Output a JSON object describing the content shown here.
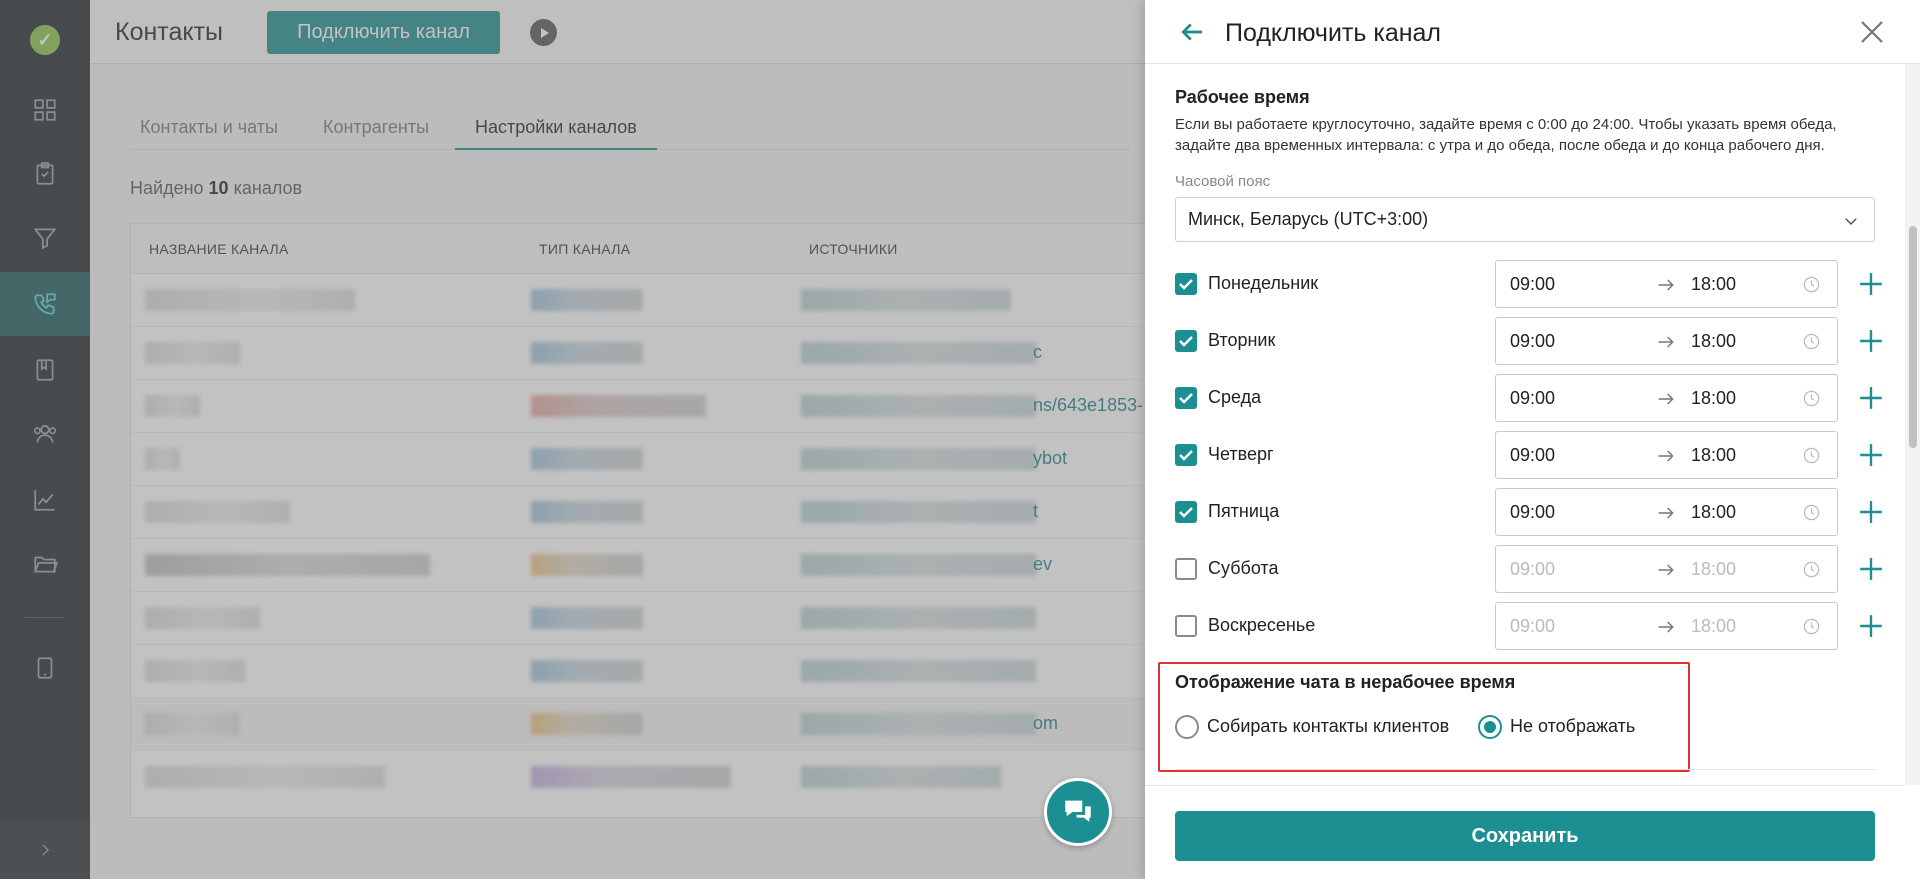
{
  "sidebar": {
    "logo_icon": "check-circle-icon",
    "items": [
      {
        "name": "dashboard",
        "icon": "grid-icon"
      },
      {
        "name": "tasks",
        "icon": "clipboard-icon"
      },
      {
        "name": "funnel",
        "icon": "funnel-icon"
      },
      {
        "name": "contacts",
        "icon": "phone-chat-icon",
        "active": true
      },
      {
        "name": "knowledge",
        "icon": "book-icon"
      },
      {
        "name": "team",
        "icon": "users-icon"
      },
      {
        "name": "analytics",
        "icon": "chart-icon"
      },
      {
        "name": "files",
        "icon": "folder-icon"
      },
      {
        "name": "mobile",
        "icon": "tablet-icon"
      }
    ],
    "expand_icon": "chevron-right-icon"
  },
  "header": {
    "title": "Контакты",
    "connect_button": "Подключить канал",
    "play_icon": "play-icon"
  },
  "tabs": [
    {
      "label": "Контакты и чаты",
      "active": false
    },
    {
      "label": "Контрагенты",
      "active": false
    },
    {
      "label": "Настройки каналов",
      "active": true
    }
  ],
  "found": {
    "prefix": "Найдено",
    "count": "10",
    "suffix": "каналов"
  },
  "table": {
    "columns": [
      "НАЗВАНИЕ КАНАЛА",
      "ТИП КАНАЛА",
      "ИСТОЧНИКИ"
    ],
    "visible_source_fragments": [
      "",
      "c",
      "ns/643e1853-",
      "ybot",
      "t",
      "ev",
      "",
      "",
      "om",
      ""
    ]
  },
  "drawer": {
    "title": "Подключить канал",
    "back_icon": "arrow-left-icon",
    "close_icon": "close-icon",
    "work_time": {
      "title": "Рабочее время",
      "description": "Если вы работаете круглосуточно, задайте время с 0:00 до 24:00. Чтобы указать время обеда, задайте два временных интервала: с утра и до обеда, после обеда и до конца рабочего дня.",
      "timezone_label": "Часовой пояс",
      "timezone_value": "Минск, Беларусь (UTC+3:00)"
    },
    "days": [
      {
        "label": "Понедельник",
        "checked": true,
        "from": "09:00",
        "to": "18:00"
      },
      {
        "label": "Вторник",
        "checked": true,
        "from": "09:00",
        "to": "18:00"
      },
      {
        "label": "Среда",
        "checked": true,
        "from": "09:00",
        "to": "18:00"
      },
      {
        "label": "Четверг",
        "checked": true,
        "from": "09:00",
        "to": "18:00"
      },
      {
        "label": "Пятница",
        "checked": true,
        "from": "09:00",
        "to": "18:00"
      },
      {
        "label": "Суббота",
        "checked": false,
        "from": "09:00",
        "to": "18:00"
      },
      {
        "label": "Воскресенье",
        "checked": false,
        "from": "09:00",
        "to": "18:00"
      }
    ],
    "nonwork": {
      "title": "Отображение чата в нерабочее время",
      "options": [
        {
          "label": "Собирать контакты клиентов",
          "selected": false
        },
        {
          "label": "Не отображать",
          "selected": true
        }
      ]
    },
    "save_button": "Сохранить"
  },
  "colors": {
    "accent": "#1b8f91",
    "sidebar": "#22272a",
    "highlight_border": "#e0302f"
  }
}
